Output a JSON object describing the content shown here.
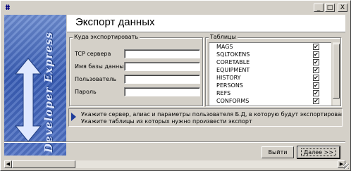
{
  "window": {
    "app_icon_glyph": "ⵌ",
    "minimize_label": "_",
    "maximize_label": "□",
    "close_label": "X"
  },
  "banner": {
    "brand_text": "Developer Express"
  },
  "header": {
    "title": "Экспорт данных"
  },
  "export_target": {
    "group_title": "Куда экспортировать",
    "fields": [
      {
        "label": "TCP сервера",
        "value": ""
      },
      {
        "label": "Имя базы данных",
        "value": ""
      },
      {
        "label": "Пользователь",
        "value": ""
      },
      {
        "label": "Пароль",
        "value": ""
      }
    ]
  },
  "tables": {
    "group_title": "Таблицы",
    "check_glyph": "✔",
    "items": [
      {
        "name": "MAGS",
        "checked": true
      },
      {
        "name": "SQLTOKENS",
        "checked": true
      },
      {
        "name": "CORETABLE",
        "checked": true
      },
      {
        "name": "EQUIPMENT",
        "checked": true
      },
      {
        "name": "HISTORY",
        "checked": true
      },
      {
        "name": "PERSONS",
        "checked": true
      },
      {
        "name": "REFS",
        "checked": true
      },
      {
        "name": "CONFORMS",
        "checked": true
      }
    ]
  },
  "info": {
    "line1": "Укажите сервер, алиас и параметры пользователя Б.Д, в которую будут экспортированы данные",
    "line2": "Укажите таблицы из которых нужно произвести экспорт"
  },
  "buttons": {
    "exit_label": "Выйти",
    "next_label": "Далее >>"
  },
  "scrollbar": {
    "left_arrow": "◀",
    "right_arrow": "▶"
  },
  "colors": {
    "banner_blue": "#3a5fb6",
    "window_face": "#d4d0c8",
    "info_arrow": "#1e3c9a"
  }
}
